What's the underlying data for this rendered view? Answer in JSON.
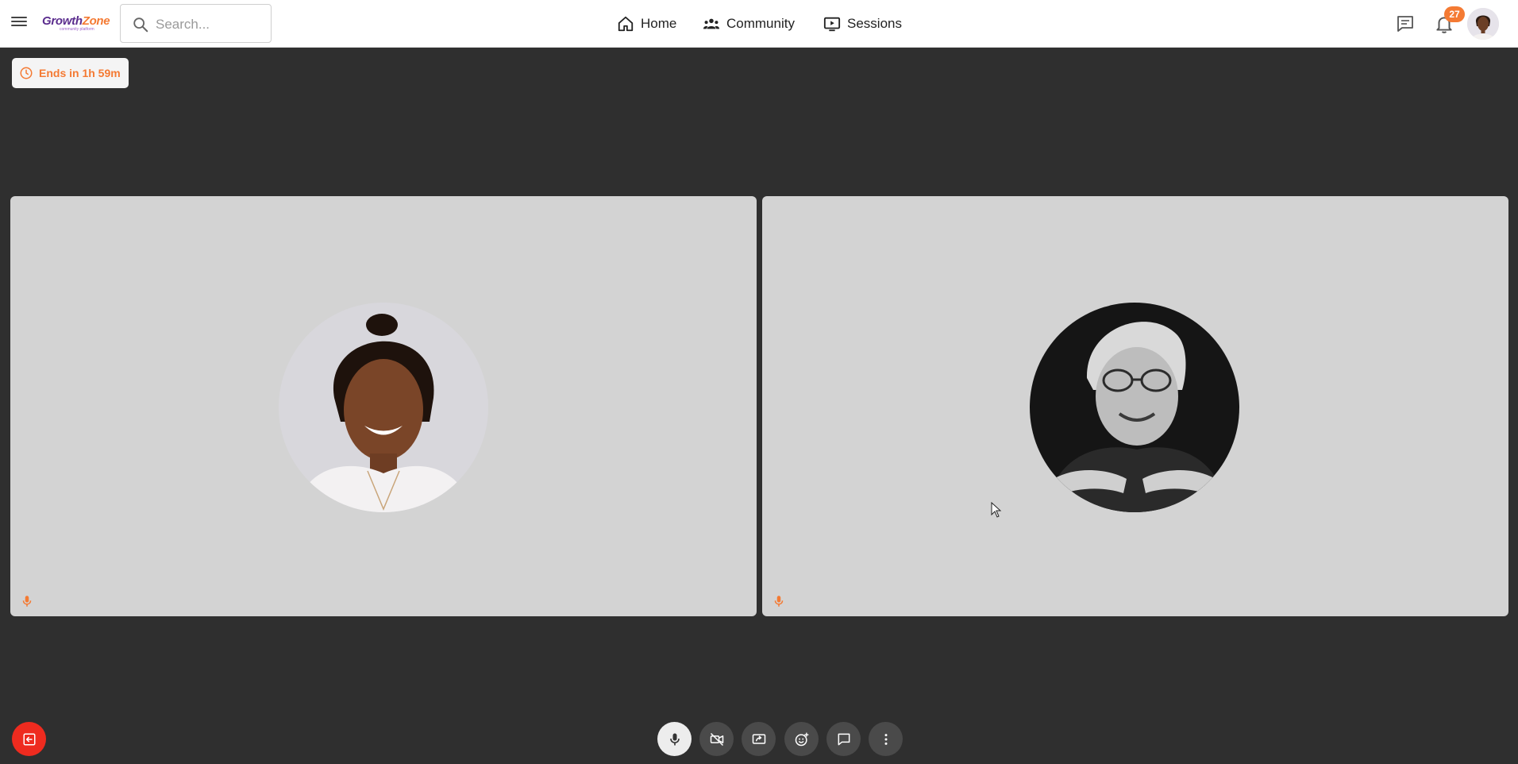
{
  "header": {
    "logo": {
      "name": "GrowthZone",
      "name_part1": "Growth",
      "name_part2": "Zone",
      "tagline": "community platform"
    },
    "search": {
      "placeholder": "Search..."
    },
    "nav": [
      {
        "label": "Home",
        "icon": "home-icon"
      },
      {
        "label": "Community",
        "icon": "community-icon"
      },
      {
        "label": "Sessions",
        "icon": "sessions-icon"
      }
    ],
    "notifications_count": "27"
  },
  "session": {
    "timer_text": "Ends in 1h 59m"
  },
  "participants": [
    {
      "avatar": "participant-woman-avatar",
      "mic": "mic-icon"
    },
    {
      "avatar": "participant-man-avatar",
      "mic": "mic-icon"
    }
  ],
  "controls": [
    {
      "icon": "mic-icon",
      "state": "on"
    },
    {
      "icon": "camera-off-icon",
      "state": "off"
    },
    {
      "icon": "screen-share-icon"
    },
    {
      "icon": "reaction-icon"
    },
    {
      "icon": "chat-icon"
    },
    {
      "icon": "more-icon"
    }
  ],
  "colors": {
    "accent": "#f47a33",
    "brand_purple": "#5b2d8e",
    "leave_red": "#ee2b1f",
    "stage_bg": "#2f2f2f",
    "tile_bg": "#d3d3d3"
  }
}
